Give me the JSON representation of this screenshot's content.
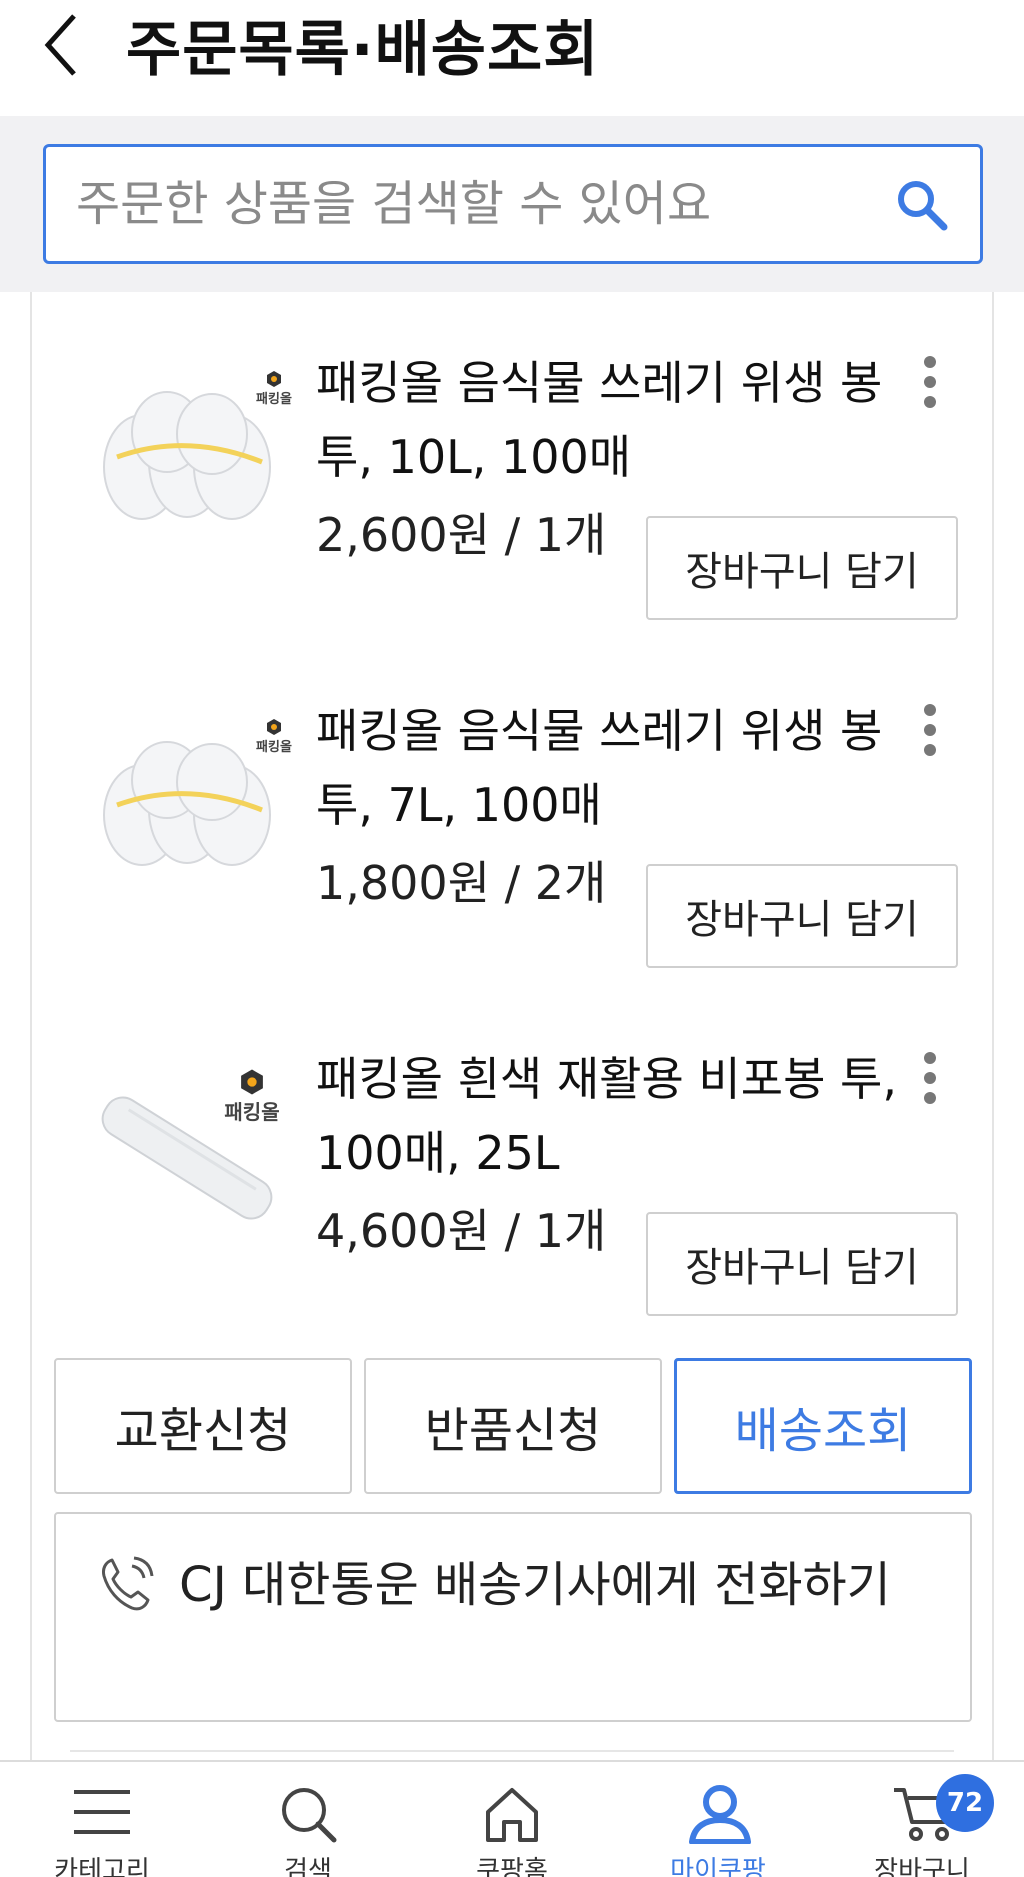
{
  "header": {
    "title": "주문목록·배송조회"
  },
  "search": {
    "placeholder": "주문한 상품을 검색할 수 있어요"
  },
  "items": [
    {
      "name": "패킹올 음식물 쓰레기 위생 봉투, 10L, 100매",
      "price": "2,600원 / 1개",
      "cart_label": "장바구니 담기",
      "brand_badge": "패킹올"
    },
    {
      "name": "패킹올 음식물 쓰레기 위생 봉투, 7L, 100매",
      "price": "1,800원 / 2개",
      "cart_label": "장바구니 담기",
      "brand_badge": "패킹올"
    },
    {
      "name": "패킹올 흰색 재활용 비포봉 투, 100매, 25L",
      "price": "4,600원 / 1개",
      "cart_label": "장바구니 담기",
      "brand_badge": "패킹올"
    }
  ],
  "actions": {
    "exchange": "교환신청",
    "return": "반품신청",
    "track": "배송조회"
  },
  "call": {
    "label": "CJ 대한통운 배송기사에게 전화하기"
  },
  "nav": {
    "items": [
      {
        "label": "카테고리",
        "icon": "menu-icon"
      },
      {
        "label": "검색",
        "icon": "search-icon"
      },
      {
        "label": "쿠팡홈",
        "icon": "home-icon"
      },
      {
        "label": "마이쿠팡",
        "icon": "user-icon"
      },
      {
        "label": "장바구니",
        "icon": "cart-icon"
      }
    ],
    "cart_count": "72",
    "active_index": 3
  },
  "colors": {
    "accent": "#3d7be3",
    "badge": "#2f6fe0"
  }
}
